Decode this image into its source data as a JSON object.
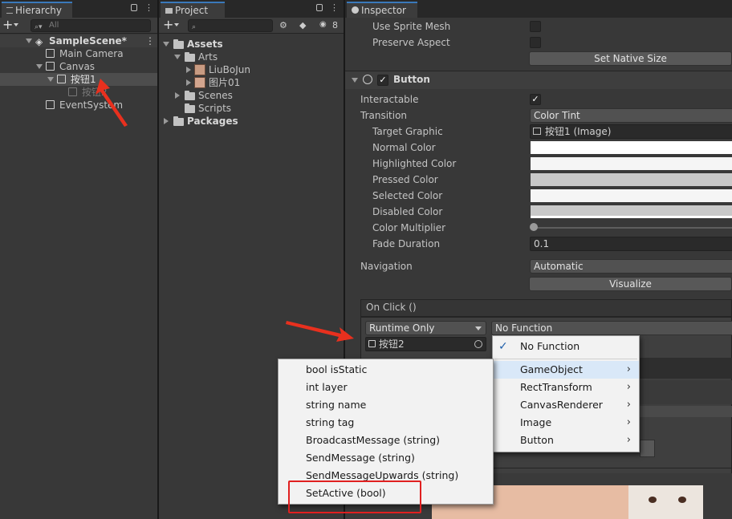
{
  "hierarchy": {
    "tab": "Hierarchy",
    "search_placeholder": "All",
    "scene": "SampleScene*",
    "items": [
      {
        "label": "Main Camera"
      },
      {
        "label": "Canvas"
      },
      {
        "label": "按钮1"
      },
      {
        "label": "按钮2"
      },
      {
        "label": "EventSystem"
      }
    ]
  },
  "project": {
    "tab": "Project",
    "hidden_count": "8",
    "tree": [
      {
        "label": "Assets"
      },
      {
        "label": "Arts"
      },
      {
        "label": "LiuBoJun"
      },
      {
        "label": "图片01"
      },
      {
        "label": "Scenes"
      },
      {
        "label": "Scripts"
      },
      {
        "label": "Packages"
      }
    ]
  },
  "inspector": {
    "tab": "Inspector",
    "use_sprite_mesh": "Use Sprite Mesh",
    "preserve_aspect": "Preserve Aspect",
    "set_native_size": "Set Native Size",
    "component_title": "Button",
    "interactable_label": "Interactable",
    "transition_label": "Transition",
    "transition_value": "Color Tint",
    "target_graphic_label": "Target Graphic",
    "target_graphic_value": "按钮1 (Image)",
    "normal_color_label": "Normal Color",
    "highlighted_color_label": "Highlighted Color",
    "pressed_color_label": "Pressed Color",
    "selected_color_label": "Selected Color",
    "disabled_color_label": "Disabled Color",
    "color_multiplier_label": "Color Multiplier",
    "fade_duration_label": "Fade Duration",
    "fade_duration_value": "0.1",
    "navigation_label": "Navigation",
    "navigation_value": "Automatic",
    "visualize_label": "Visualize",
    "on_click_label": "On Click ()",
    "runtime_value": "Runtime Only",
    "function_value": "No Function",
    "object_value": "按钮2"
  },
  "function_menu": {
    "items": [
      {
        "label": "No Function",
        "checked": true
      },
      {
        "label": "GameObject",
        "submenu": true
      },
      {
        "label": "RectTransform",
        "submenu": true
      },
      {
        "label": "CanvasRenderer",
        "submenu": true
      },
      {
        "label": "Image",
        "submenu": true
      },
      {
        "label": "Button",
        "submenu": true
      }
    ]
  },
  "gameobject_menu": {
    "items": [
      {
        "label": "bool isStatic"
      },
      {
        "label": "int layer"
      },
      {
        "label": "string name"
      },
      {
        "label": "string tag"
      },
      {
        "label": "BroadcastMessage (string)"
      },
      {
        "label": "SendMessage (string)"
      },
      {
        "label": "SendMessageUpwards (string)"
      },
      {
        "label": "SetActive (bool)"
      }
    ]
  },
  "colors": {
    "accent": "#3a79bb",
    "highlight_box": "#e02020",
    "arrow": "#e8301e"
  }
}
